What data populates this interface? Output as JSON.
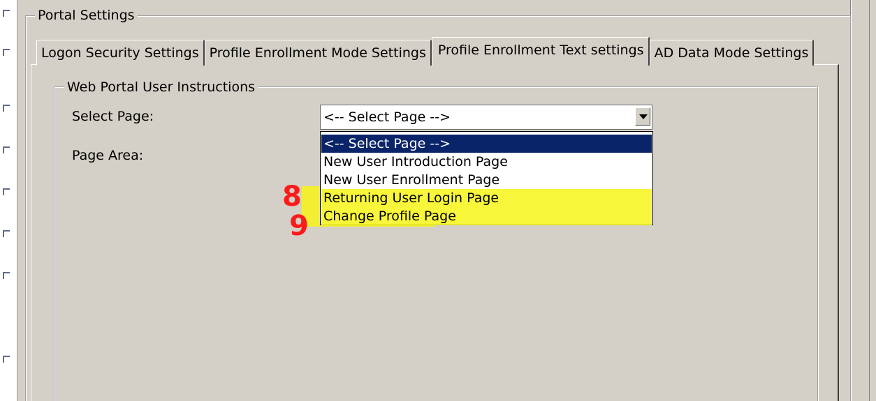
{
  "group": {
    "portal_title": "Portal Settings",
    "web_title": "Web Portal User Instructions"
  },
  "tabs": [
    {
      "label": "Logon Security Settings"
    },
    {
      "label": "Profile Enrollment Mode Settings"
    },
    {
      "label": "Profile Enrollment Text settings"
    },
    {
      "label": "AD Data Mode Settings"
    }
  ],
  "form": {
    "select_page_label": "Select Page:",
    "page_area_label": "Page Area:",
    "selected_value": "<-- Select Page -->"
  },
  "dropdown": {
    "options": [
      {
        "label": "<-- Select Page -->"
      },
      {
        "label": "New User Introduction Page"
      },
      {
        "label": "New User Enrollment Page"
      },
      {
        "label": "Returning User Login Page"
      },
      {
        "label": "Change Profile Page"
      }
    ]
  },
  "annotations": {
    "mark_8": "8",
    "mark_9": "9"
  },
  "colors": {
    "window_bg": "#d4d0c8",
    "selection": "#0a246a",
    "highlighter": "#f7f417",
    "ink": "#ff1a1a"
  }
}
